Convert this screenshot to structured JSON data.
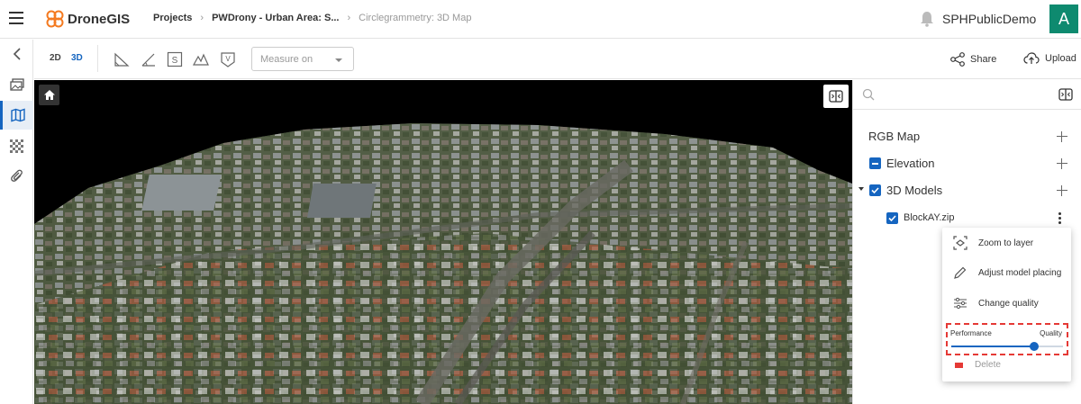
{
  "header": {
    "app_name": "DroneGIS",
    "breadcrumbs": [
      "Projects",
      "PWDrony - Urban Area: S...",
      "Circlegrammetry: 3D Map"
    ],
    "username": "SPHPublicDemo",
    "avatar_letter": "A",
    "avatar_color": "#0e8a6f",
    "brand_color": "#f47a20"
  },
  "rail": {
    "items": [
      "back-icon",
      "gallery-icon",
      "map-icon",
      "grid-icon",
      "attachment-icon"
    ],
    "active": "map-icon"
  },
  "toolbar": {
    "mode_2d": "2D",
    "mode_3d": "3D",
    "active_mode": "3D",
    "tools": [
      "measure-area-icon",
      "measure-angle-icon",
      "measure-surface-icon",
      "measure-profile-icon",
      "measure-volume-icon"
    ],
    "measure_placeholder": "Measure on",
    "share_label": "Share",
    "upload_label": "Upload"
  },
  "panel": {
    "search_placeholder": "",
    "layers": [
      {
        "label": "RGB Map",
        "checkbox": "none"
      },
      {
        "label": "Elevation",
        "checkbox": "partial"
      },
      {
        "label": "3D Models",
        "checkbox": "checked",
        "expanded": true
      },
      {
        "label": "BlockAY.zip",
        "checkbox": "checked"
      }
    ]
  },
  "context_menu": {
    "items": [
      "Zoom to layer",
      "Adjust model placing",
      "Change quality"
    ],
    "slider": {
      "left_label": "Performance",
      "right_label": "Quality",
      "value": 0.74
    },
    "partially_hidden_item": "Delete"
  },
  "accent_color": "#1565c0",
  "highlight_color": "#e53935"
}
